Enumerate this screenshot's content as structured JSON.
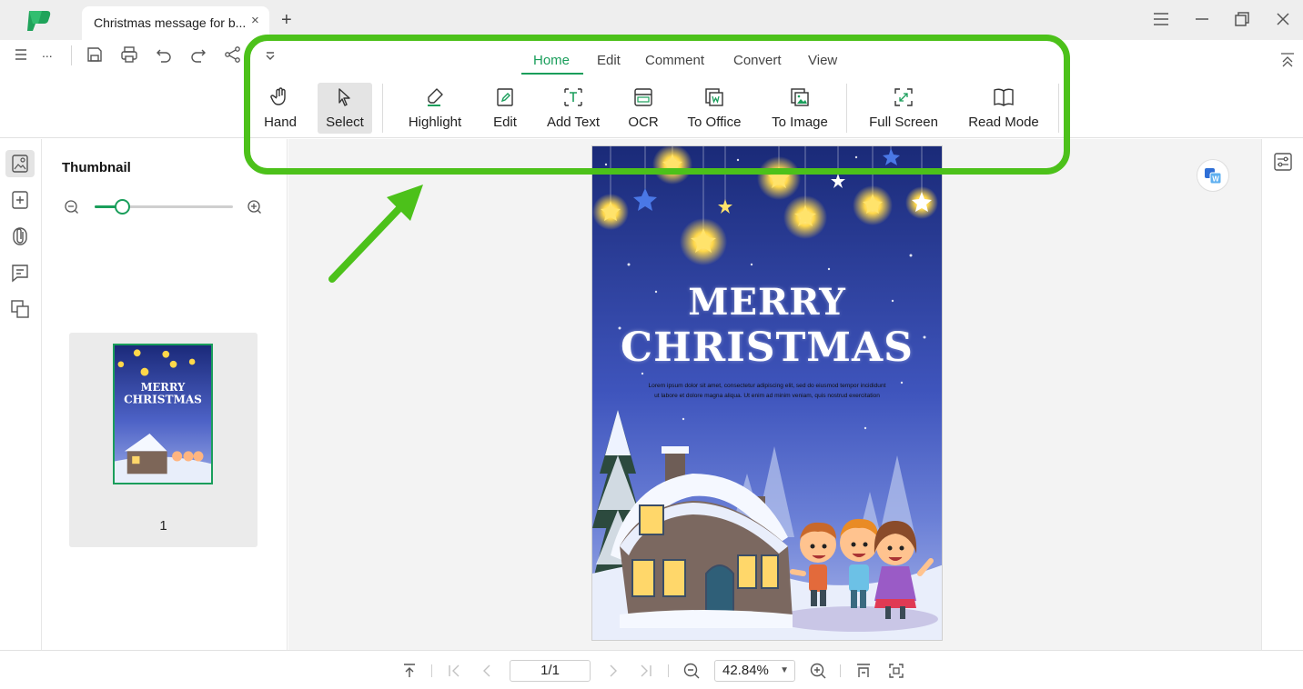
{
  "window": {
    "tab_title": "Christmas message for b...",
    "tab_close": "×",
    "tab_add": "+"
  },
  "quick_access": {
    "overflow": "..."
  },
  "ribbon": {
    "tabs": [
      {
        "label": "Home",
        "active": true
      },
      {
        "label": "Edit"
      },
      {
        "label": "Comment"
      },
      {
        "label": "Convert"
      },
      {
        "label": "View"
      }
    ],
    "buttons": [
      {
        "label": "Hand",
        "icon": "hand-icon"
      },
      {
        "label": "Select",
        "icon": "cursor-icon",
        "selected": true
      },
      {
        "label": "Highlight",
        "icon": "highlighter-icon"
      },
      {
        "label": "Edit",
        "icon": "edit-icon"
      },
      {
        "label": "Add Text",
        "icon": "add-text-icon"
      },
      {
        "label": "OCR",
        "icon": "ocr-icon"
      },
      {
        "label": "To Office",
        "icon": "to-office-icon"
      },
      {
        "label": "To Image",
        "icon": "to-image-icon"
      },
      {
        "label": "Full Screen",
        "icon": "full-screen-icon"
      },
      {
        "label": "Read Mode",
        "icon": "book-icon"
      }
    ]
  },
  "thumbnail_panel": {
    "title": "Thumbnail",
    "zoom_level": 0.2,
    "pages": [
      {
        "number": "1"
      }
    ]
  },
  "document": {
    "title_line1": "MERRY",
    "title_line2": "CHRISTMAS",
    "body": "Lorem ipsum dolor sit amet, consectetur adipiscing elit, sed do eiusmod tempor incididunt ut labore et dolore magna aliqua. Ut enim ad minim veniam, quis nostrud exercitation"
  },
  "statusbar": {
    "page_indicator": "1/1",
    "zoom": "42.84%"
  },
  "colors": {
    "accent": "#1a9e5b",
    "annotation": "#4cc11a",
    "page_sky_top": "#1a2a78",
    "page_sky_bottom": "#8c9de0"
  }
}
